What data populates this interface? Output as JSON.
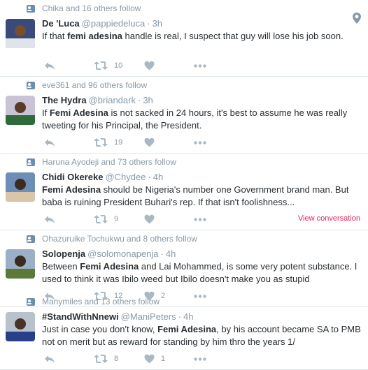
{
  "tweets": [
    {
      "context": "Chika and 16 others follow",
      "name": "De 'Luca",
      "handle": "@pappiedeluca",
      "time": "3h",
      "body_html": "If that <b>femi adesina</b> handle is real, I suspect that guy will lose his job soon.",
      "retweets": "10",
      "likes": "",
      "view_conversation": "",
      "has_location": true,
      "avatar_colors": [
        "#3a4a7a",
        "#dfe3ea",
        "#7a4d2c"
      ]
    },
    {
      "context": "eve361 and 96 others follow",
      "name": "The Hydra",
      "handle": "@briandark",
      "time": "3h",
      "body_html": "If <b>Femi Adesina</b> is not sacked in 24 hours, it's best to assume he was really tweeting for his Principal, the President.",
      "retweets": "19",
      "likes": "",
      "view_conversation": "",
      "has_location": false,
      "avatar_colors": [
        "#c9c3d6",
        "#2f6b3a",
        "#5a3b2a"
      ]
    },
    {
      "context": "Haruna Ayodeji and 73 others follow",
      "name": "Chidi Okereke",
      "handle": "@Chydee",
      "time": "4h",
      "body_html": "<b>Femi Adesina</b> should be Nigeria's number one Government brand man. But baba is ruining President Buhari's rep. If that isn't foolishness...",
      "retweets": "9",
      "likes": "",
      "view_conversation": "View conversation",
      "has_location": false,
      "avatar_colors": [
        "#6d8fb7",
        "#d9c5a8",
        "#3e2a1f"
      ]
    },
    {
      "context": "Ohazuruike Tochukwu and 8 others follow",
      "name": "Solopenja",
      "handle": "@solomonapenja",
      "time": "4h",
      "body_html": "Between <b>Femi Adesina</b> and Lai Mohammed, is some very potent substance. I used to think it was Ibilo weed but Ibilo doesn't make you as stupid",
      "retweets": "12",
      "likes": "2",
      "view_conversation": "",
      "has_location": false,
      "avatar_colors": [
        "#9bb0c7",
        "#5b7a3a",
        "#3a2b20"
      ]
    },
    {
      "context": "Manymiles and 13 others follow",
      "name": "#StandWithNnewi",
      "handle": "@ManiPeters",
      "time": "4h",
      "body_html": "Just in case you don't know, <b>Femi Adesina</b>, by his account became SA to PMB not on merit but as reward for standing by him thro the years 1/",
      "retweets": "8",
      "likes": "1",
      "view_conversation": "",
      "has_location": false,
      "avatar_colors": [
        "#b8c2cc",
        "#2a3f8a",
        "#4a3226"
      ]
    }
  ],
  "icons": {
    "reply": "reply-icon",
    "retweet": "retweet-icon",
    "like": "heart-icon",
    "more": "more-icon",
    "context": "follow-context-icon",
    "location": "location-pin-icon"
  },
  "colors": {
    "text": "#292f33",
    "muted": "#8899a6",
    "icon": "#aab8c2",
    "divider": "#e1e8ed",
    "link_red": "#e0245e"
  }
}
